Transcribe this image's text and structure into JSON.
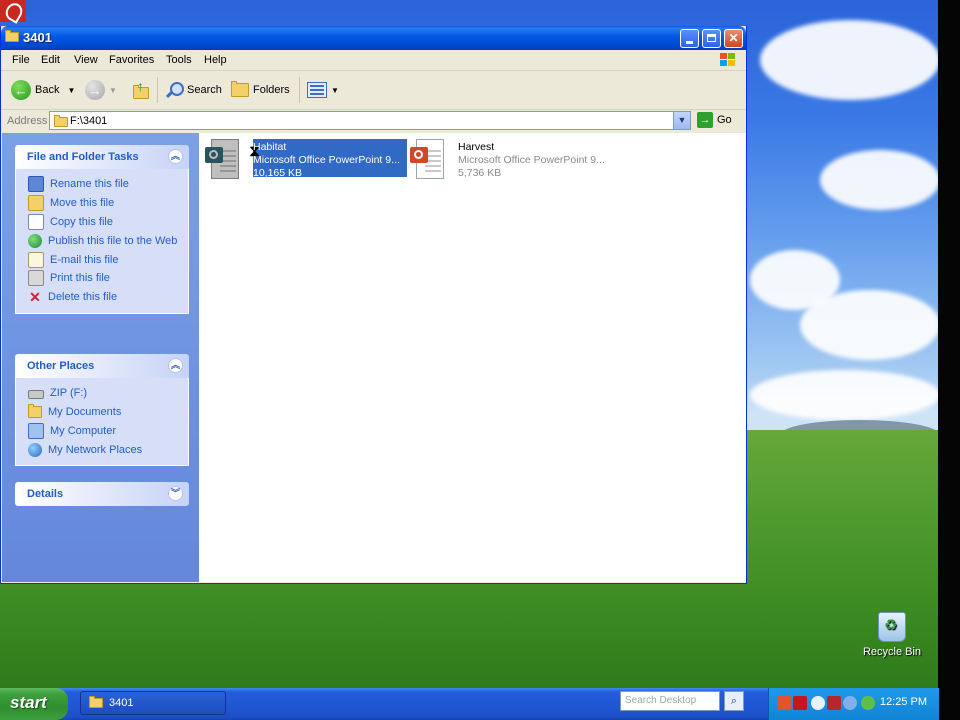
{
  "window": {
    "title": "3401",
    "menu": [
      "File",
      "Edit",
      "View",
      "Favorites",
      "Tools",
      "Help"
    ],
    "toolbar": {
      "back_label": "Back",
      "search_label": "Search",
      "folders_label": "Folders"
    },
    "address": {
      "label": "Address",
      "value": "F:\\3401",
      "go_label": "Go"
    }
  },
  "left_pane": {
    "file_tasks": {
      "title": "File and Folder Tasks",
      "items": [
        {
          "label": "Rename this file",
          "icon": "rename-icon"
        },
        {
          "label": "Move this file",
          "icon": "move-icon"
        },
        {
          "label": "Copy this file",
          "icon": "copy-icon"
        },
        {
          "label": "Publish this file to the Web",
          "icon": "globe-icon"
        },
        {
          "label": "E-mail this file",
          "icon": "email-icon"
        },
        {
          "label": "Print this file",
          "icon": "printer-icon"
        },
        {
          "label": "Delete this file",
          "icon": "delete-icon"
        }
      ]
    },
    "other_places": {
      "title": "Other Places",
      "items": [
        {
          "label": "ZIP (F:)",
          "icon": "zip-drive-icon"
        },
        {
          "label": "My Documents",
          "icon": "folder-icon"
        },
        {
          "label": "My Computer",
          "icon": "computer-icon"
        },
        {
          "label": "My Network Places",
          "icon": "network-icon"
        }
      ]
    },
    "details": {
      "title": "Details"
    }
  },
  "files": [
    {
      "name": "Habitat",
      "type": "Microsoft Office PowerPoint 9...",
      "size": "10,165 KB",
      "selected": true
    },
    {
      "name": "Harvest",
      "type": "Microsoft Office PowerPoint 9...",
      "size": "5,736 KB",
      "selected": false
    }
  ],
  "desktop": {
    "recycle_bin_label": "Recycle Bin"
  },
  "taskbar": {
    "start_label": "start",
    "window_button_label": "3401",
    "search_placeholder": "Search Desktop",
    "clock": "12:25 PM"
  },
  "colors": {
    "title_blue": "#0058e6",
    "selection_blue": "#316ac5",
    "task_link": "#215dc6",
    "start_green": "#3c9f3c"
  }
}
